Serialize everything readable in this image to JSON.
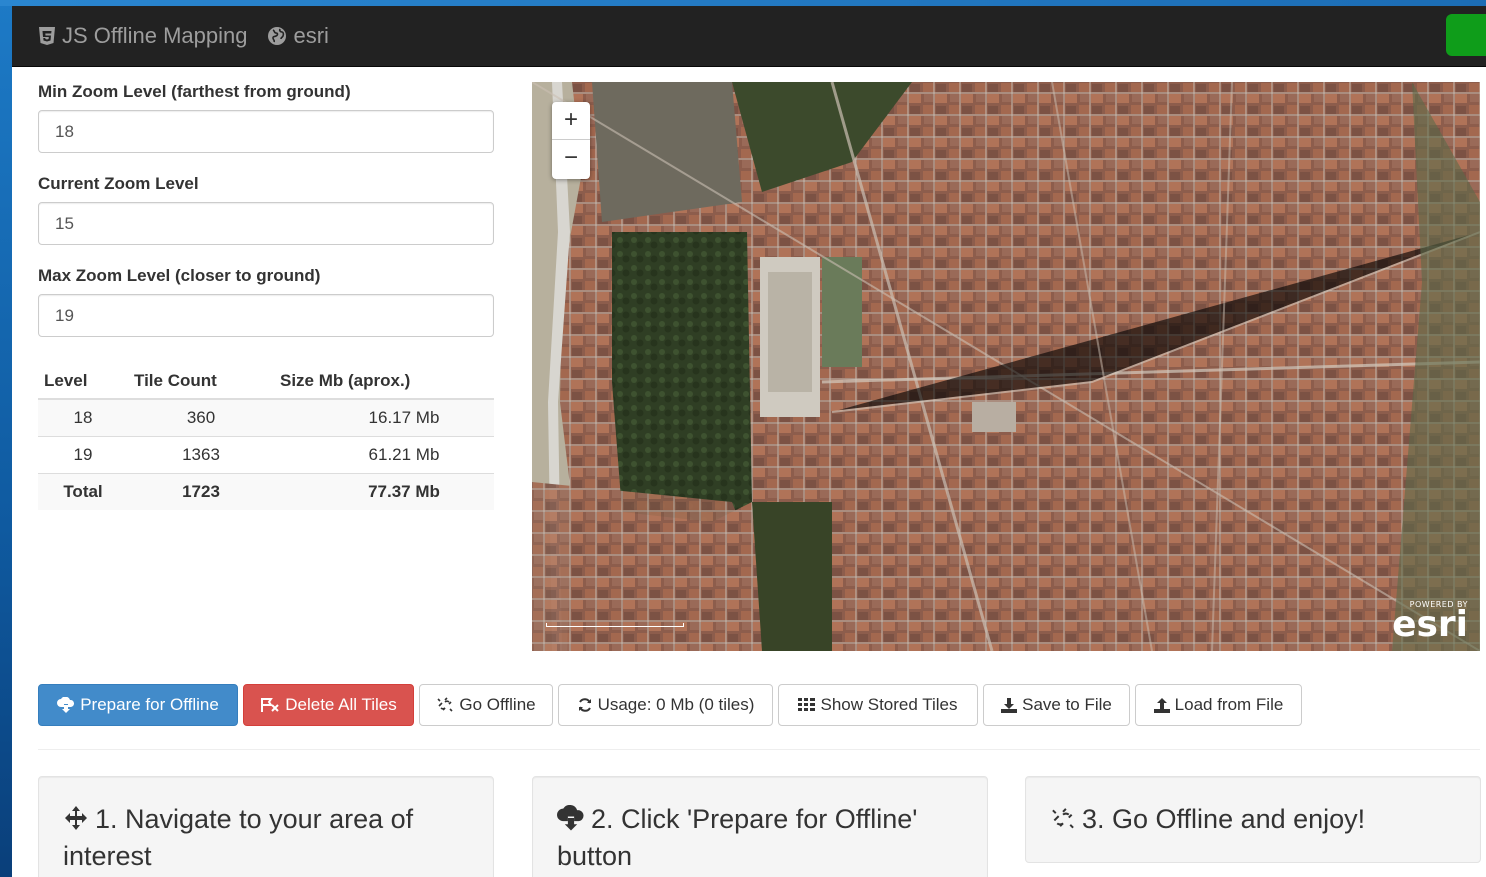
{
  "navbar": {
    "title": "JS Offline Mapping",
    "esri_label": "esri"
  },
  "form": {
    "min_zoom": {
      "label": "Min Zoom Level (farthest from ground)",
      "value": "18"
    },
    "current_zoom": {
      "label": "Current Zoom Level",
      "value": "15"
    },
    "max_zoom": {
      "label": "Max Zoom Level (closer to ground)",
      "value": "19"
    }
  },
  "table": {
    "headers": [
      "Level",
      "Tile Count",
      "Size Mb (aprox.)"
    ],
    "rows": [
      [
        "18",
        "360",
        "16.17 Mb"
      ],
      [
        "19",
        "1363",
        "61.21 Mb"
      ]
    ],
    "total": [
      "Total",
      "1723",
      "77.37 Mb"
    ]
  },
  "map": {
    "zoom_in": "+",
    "zoom_out": "−",
    "logo_powered": "POWERED BY",
    "logo_name": "esri"
  },
  "toolbar": {
    "prepare": "Prepare for Offline",
    "delete": "Delete All Tiles",
    "go_offline": "Go Offline",
    "usage": "Usage: 0 Mb (0 tiles)",
    "show_stored": "Show Stored Tiles",
    "save_file": "Save to File",
    "load_file": "Load from File"
  },
  "steps": [
    {
      "text": "1. Navigate to your area of interest",
      "icon": "move-icon"
    },
    {
      "text": "2. Click 'Prepare for Offline' button",
      "icon": "cloud-download-icon"
    },
    {
      "text": "3. Go Offline and enjoy!",
      "icon": "disconnect-icon"
    }
  ],
  "colors": {
    "navbar": "#222222",
    "primary": "#428bca",
    "danger": "#d9534f",
    "nav_button": "#0f9d1a"
  }
}
